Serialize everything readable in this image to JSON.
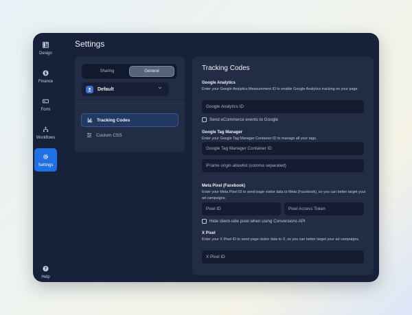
{
  "nav": {
    "design": "Design",
    "finance": "Finance",
    "form": "Form",
    "workflows": "Workflows",
    "settings": "Settings",
    "help": "Help"
  },
  "header": {
    "title": "Settings"
  },
  "left_panel": {
    "segment": {
      "tab1": "Sharing",
      "tab2": "General",
      "selected": "General"
    },
    "profile": {
      "name": "Default"
    },
    "menu": [
      {
        "label": "Tracking Codes",
        "icon": "bar-chart-icon",
        "active": true
      },
      {
        "label": "Custom CSS",
        "icon": "sliders-icon",
        "active": false
      }
    ]
  },
  "tracking": {
    "title": "Tracking Codes",
    "google_analytics": {
      "heading": "Google Analytics",
      "description": "Enter your Google Analytics Measurement ID to enable Google Analytics tracking on your page.",
      "id_placeholder": "Google Analytics ID",
      "ecommerce_label": "Send eCommerce events to Google"
    },
    "gtm": {
      "heading": "Google Tag Manager",
      "description": "Enter your Google Tag Manager Container ID to manage all your tags.",
      "id_placeholder": "Google Tag Manager Container ID",
      "iframe_placeholder": "iFrame origin allowlist (comma separated)"
    },
    "meta": {
      "heading": "Meta Pixel (Facebook)",
      "description": "Enter your Meta Pixel ID to send page visitor data to Meta (Facebook), so you can better target your ad campaigns.",
      "pixel_id_placeholder": "Pixel ID",
      "token_placeholder": "Pixel Access Token",
      "hide_label": "Hide client-side pixel when using Conversions API"
    },
    "x_pixel": {
      "heading": "X Pixel",
      "description": "Enter your X Pixel ID to send page visitor data to X, so you can better target your ad campaigns.",
      "id_placeholder": "X Pixel ID"
    }
  },
  "colors": {
    "accent": "#1f6fe5",
    "window_bg": "#17223a",
    "panel_bg": "#222d45"
  }
}
